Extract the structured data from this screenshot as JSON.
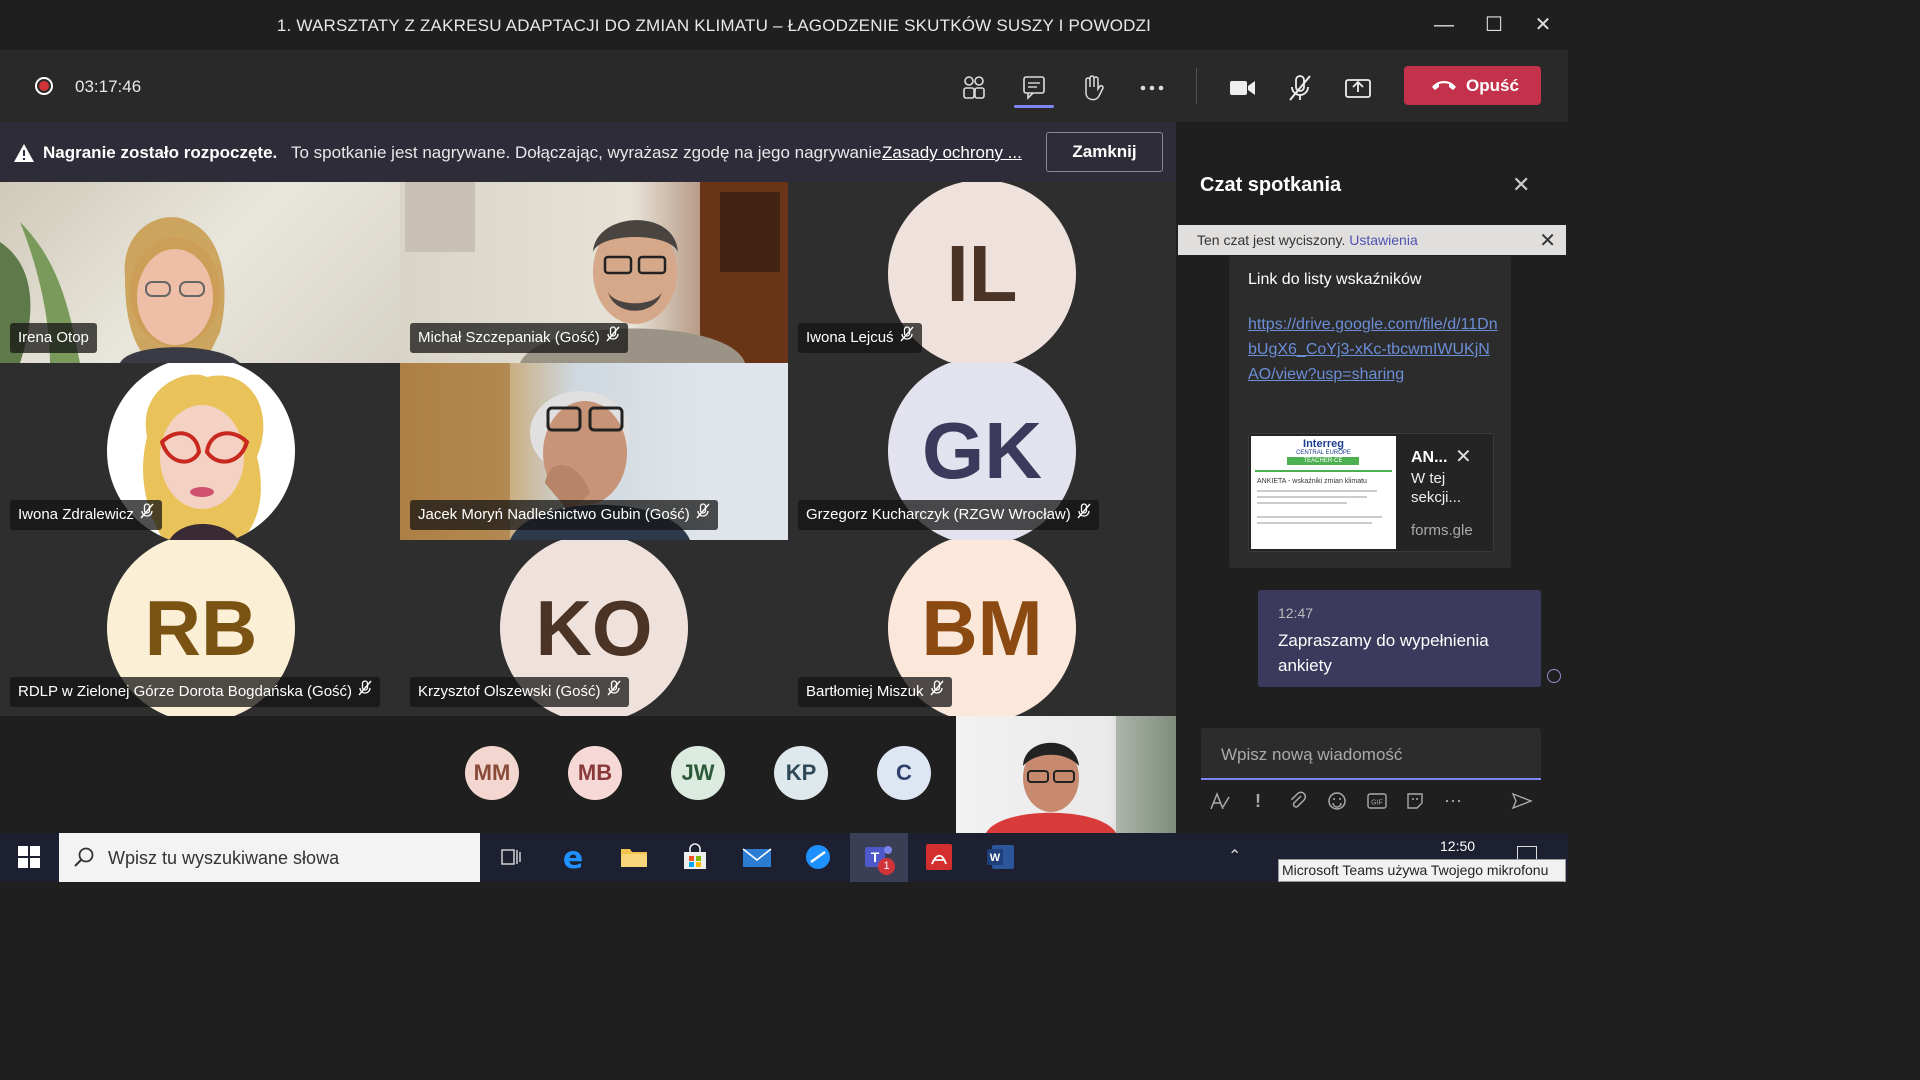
{
  "window": {
    "title": "1. WARSZTATY Z ZAKRESU ADAPTACJI DO ZMIAN KLIMATU – ŁAGODZENIE SKUTKÓW SUSZY I POWODZI",
    "minimize_icon": "minimize-icon",
    "maximize_icon": "maximize-icon",
    "close_icon": "close-icon"
  },
  "toolbar": {
    "timer": "03:17:46",
    "leave_label": "Opuść",
    "leave_color": "#c4314b"
  },
  "banner": {
    "bold": "Nagranie zostało rozpoczęte.",
    "text": "To spotkanie jest nagrywane. Dołączając, wyrażasz zgodę na jego nagrywanie.",
    "link": "Zasady ochrony ...",
    "close_label": "Zamknij"
  },
  "participants": [
    {
      "name": "Irena Otop",
      "type": "video"
    },
    {
      "name": "Michał Szczepaniak (Gość)",
      "type": "video"
    },
    {
      "name": "Iwona Lejcuś",
      "type": "avatar",
      "initials": "IL"
    },
    {
      "name": "Iwona Zdralewicz",
      "type": "drawing"
    },
    {
      "name": "Jacek Moryń Nadleśnictwo Gubin (Gość)",
      "type": "video"
    },
    {
      "name": "Grzegorz Kucharczyk (RZGW Wrocław)",
      "type": "avatar",
      "initials": "GK"
    },
    {
      "name": "RDLP w Zielonej Górze Dorota Bogdańska (Gość)",
      "type": "avatar",
      "initials": "RB"
    },
    {
      "name": "Krzysztof Olszewski (Gość)",
      "type": "avatar",
      "initials": "KO"
    },
    {
      "name": "Bartłomiej Miszuk",
      "type": "avatar",
      "initials": "BM"
    }
  ],
  "overflow_participants": [
    "MM",
    "MB",
    "JW",
    "KP",
    "C"
  ],
  "chat": {
    "title": "Czat spotkania",
    "muted_text": "Ten czat jest wyciszony.",
    "muted_link": "Ustawienia",
    "link_heading": "Link do listy wskaźników",
    "url": "https://drive.google.com/file/d/11DnbUgX6_CoYj3-xKc-tbcwmIWUKjNAO/view?usp=sharing",
    "preview_title": "AN...",
    "preview_desc": "W tej sekcji...",
    "preview_domain": "forms.gle",
    "preview_thumb_logo": "Interreg",
    "preview_thumb_sub": "CENTRAL EUROPE",
    "preview_thumb_tag": "TEACHER-CE",
    "preview_thumb_heading": "ANKIETA - wskaźniki zmian klimatu",
    "my_time": "12:47",
    "my_text": "Zapraszamy do wypełnienia ankiety",
    "composer_placeholder": "Wpisz nową wiadomość"
  },
  "taskbar": {
    "search_placeholder": "Wpisz tu wyszukiwane słowa",
    "clock": "12:50",
    "teams_badge": "1",
    "toast": "Microsoft Teams używa Twojego mikrofonu"
  }
}
